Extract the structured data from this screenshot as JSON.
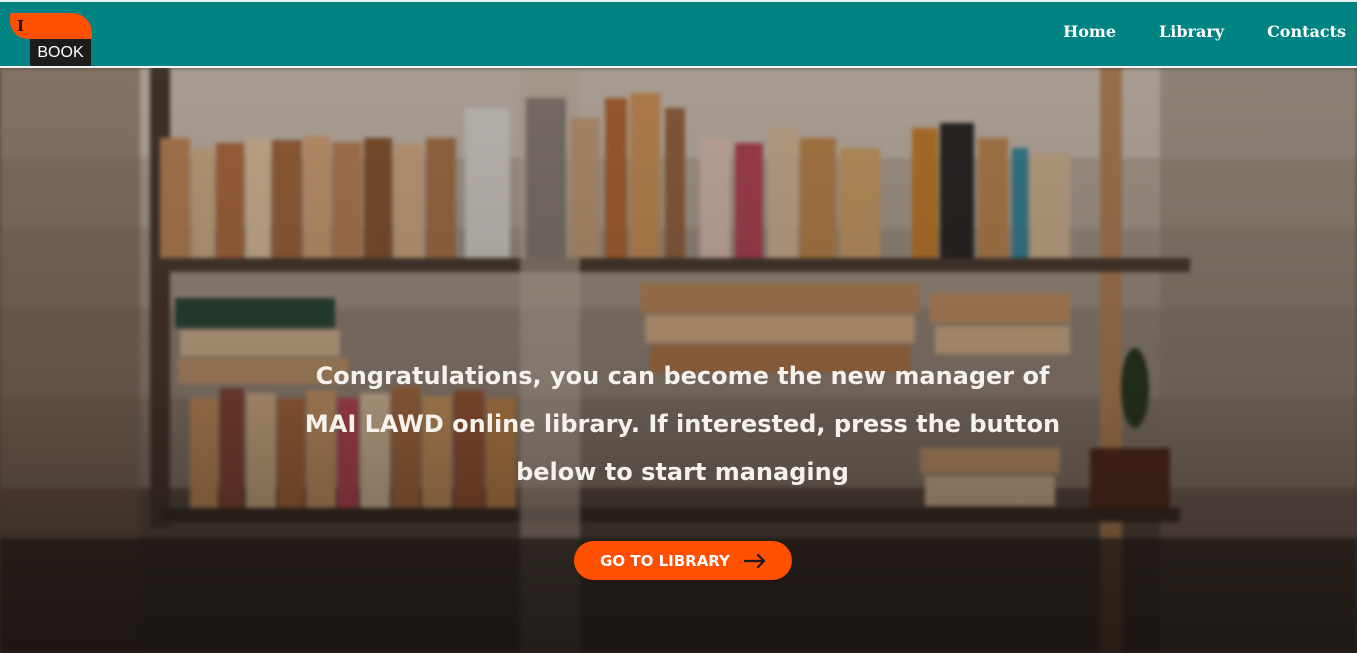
{
  "logo": {
    "letter": "I",
    "word": "BOOK"
  },
  "nav": {
    "items": [
      {
        "label": "Home"
      },
      {
        "label": "Library"
      },
      {
        "label": "Contacts"
      }
    ]
  },
  "hero": {
    "message": "Congratulations, you can become the new manager of MAI LAWD online library. If interested, press the button below to start managing",
    "button_label": "GO TO LIBRARY",
    "button_icon": "arrow-right-icon",
    "background": "blurred bookshelf photo"
  },
  "colors": {
    "header": "#018384",
    "accent": "#ff4f00",
    "nav_text": "#ffffff",
    "hero_text": "#f5f1ec"
  }
}
